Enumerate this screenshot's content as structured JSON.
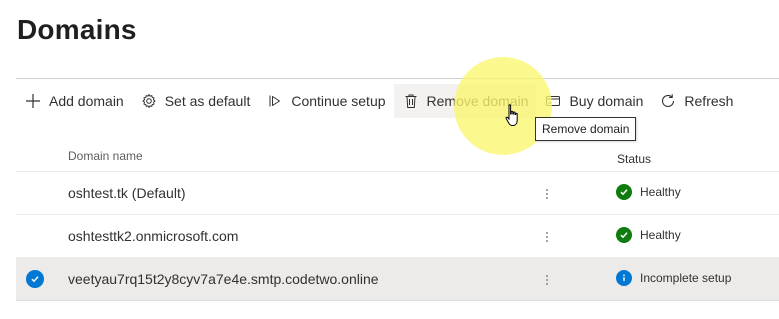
{
  "page": {
    "title": "Domains"
  },
  "toolbar": {
    "add_domain": "Add domain",
    "set_default": "Set as default",
    "continue_setup": "Continue setup",
    "remove_domain": "Remove domain",
    "buy_domain": "Buy domain",
    "refresh": "Refresh"
  },
  "tooltip": {
    "text": "Remove domain"
  },
  "table": {
    "columns": {
      "name": "Domain name",
      "status": "Status"
    },
    "rows": [
      {
        "name": "oshtest.tk (Default)",
        "status": "Healthy",
        "status_type": "healthy",
        "selected": false
      },
      {
        "name": "oshtesttk2.onmicrosoft.com",
        "status": "Healthy",
        "status_type": "healthy",
        "selected": false
      },
      {
        "name": "veetyau7rq15t2y8cyv7a7e4e.smtp.codetwo.online",
        "status": "Incomplete setup",
        "status_type": "info",
        "selected": true
      }
    ]
  },
  "colors": {
    "accent": "#0078d4",
    "healthy": "#107c10",
    "highlight": "#faf66e"
  },
  "icons": [
    "add-icon",
    "gear-icon",
    "play-outline-icon",
    "trash-icon",
    "card-icon",
    "refresh-icon",
    "more-vertical-icon",
    "checkmark-circle-icon",
    "info-circle-icon",
    "hand-cursor-icon"
  ]
}
